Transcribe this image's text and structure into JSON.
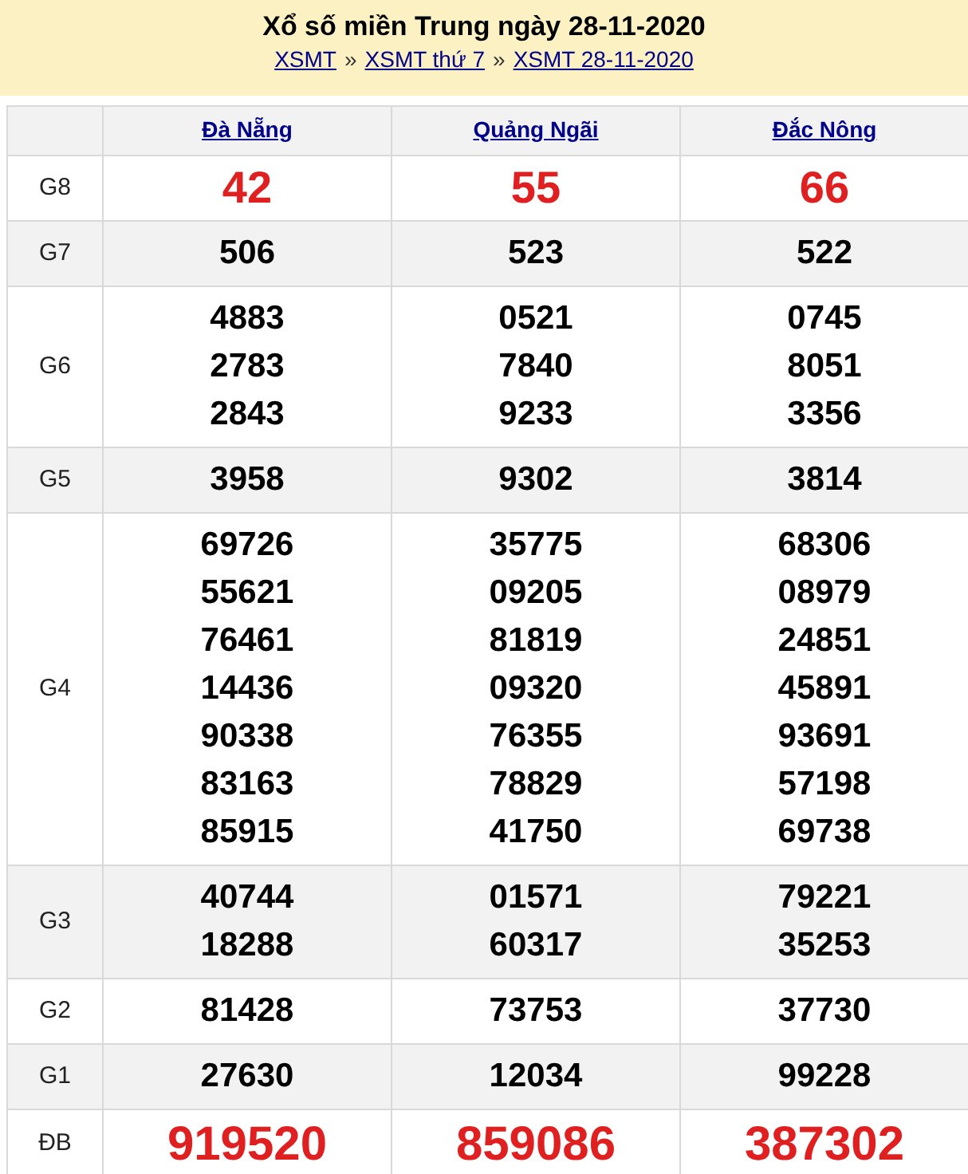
{
  "header": {
    "title": "Xổ số miền Trung ngày 28-11-2020",
    "breadcrumbs": [
      {
        "label": "XSMT",
        "separator": "»"
      },
      {
        "label": "XSMT thứ 7",
        "separator": "»"
      },
      {
        "label": "XSMT 28-11-2020"
      }
    ]
  },
  "table": {
    "columns": [
      "Đà Nẵng",
      "Quảng Ngãi",
      "Đắc Nông"
    ],
    "rows": [
      {
        "prize": "G8",
        "kind": "highlight",
        "cells": [
          [
            "42"
          ],
          [
            "55"
          ],
          [
            "66"
          ]
        ]
      },
      {
        "prize": "G7",
        "kind": "normal",
        "cells": [
          [
            "506"
          ],
          [
            "523"
          ],
          [
            "522"
          ]
        ]
      },
      {
        "prize": "G6",
        "kind": "normal",
        "cells": [
          [
            "4883",
            "2783",
            "2843"
          ],
          [
            "0521",
            "7840",
            "9233"
          ],
          [
            "0745",
            "8051",
            "3356"
          ]
        ]
      },
      {
        "prize": "G5",
        "kind": "normal",
        "cells": [
          [
            "3958"
          ],
          [
            "9302"
          ],
          [
            "3814"
          ]
        ]
      },
      {
        "prize": "G4",
        "kind": "normal",
        "cells": [
          [
            "69726",
            "55621",
            "76461",
            "14436",
            "90338",
            "83163",
            "85915"
          ],
          [
            "35775",
            "09205",
            "81819",
            "09320",
            "76355",
            "78829",
            "41750"
          ],
          [
            "68306",
            "08979",
            "24851",
            "45891",
            "93691",
            "57198",
            "69738"
          ]
        ]
      },
      {
        "prize": "G3",
        "kind": "normal",
        "cells": [
          [
            "40744",
            "18288"
          ],
          [
            "01571",
            "60317"
          ],
          [
            "79221",
            "35253"
          ]
        ]
      },
      {
        "prize": "G2",
        "kind": "normal",
        "cells": [
          [
            "81428"
          ],
          [
            "73753"
          ],
          [
            "37730"
          ]
        ]
      },
      {
        "prize": "G1",
        "kind": "normal",
        "cells": [
          [
            "27630"
          ],
          [
            "12034"
          ],
          [
            "99228"
          ]
        ]
      },
      {
        "prize": "ĐB",
        "kind": "highlight",
        "cells": [
          [
            "919520"
          ],
          [
            "859086"
          ],
          [
            "387302"
          ]
        ]
      }
    ]
  }
}
